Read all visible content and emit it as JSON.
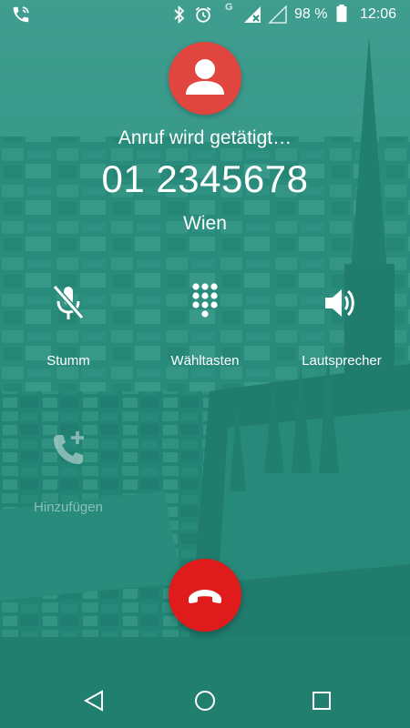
{
  "status_bar": {
    "battery_percent": "98 %",
    "time": "12:06",
    "network_letter": "G",
    "icons": [
      "phone-call-icon",
      "bluetooth-icon",
      "alarm-icon",
      "signal-no-data-icon",
      "signal-empty-icon",
      "battery-icon"
    ]
  },
  "call": {
    "status": "Anruf wird getätigt…",
    "number": "01 2345678",
    "location": "Wien"
  },
  "actions": {
    "mute": {
      "label": "Stumm",
      "icon": "mic-off-icon"
    },
    "dialpad": {
      "label": "Wähltasten",
      "icon": "dialpad-icon"
    },
    "speaker": {
      "label": "Lautsprecher",
      "icon": "speaker-icon"
    },
    "add_call": {
      "label": "Hinzufügen",
      "icon": "add-call-icon"
    }
  },
  "end_call": {
    "icon": "call-end-icon"
  },
  "nav": {
    "icons": [
      "back-icon",
      "home-icon",
      "recents-icon"
    ]
  },
  "colors": {
    "background_tint": "#1f8c7a",
    "avatar": "#e0453f",
    "end_call": "#e01b1b",
    "text": "#ffffff"
  }
}
